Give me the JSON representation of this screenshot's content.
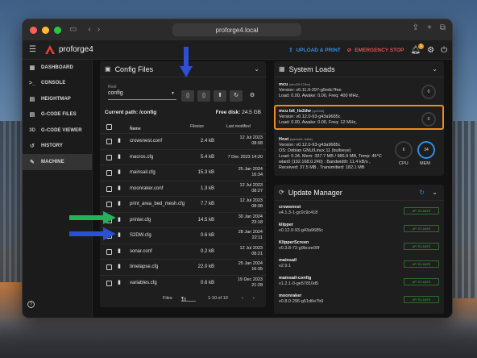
{
  "browser": {
    "url": "proforge4.local"
  },
  "app": {
    "brand": "proforge4",
    "upload_label": "UPLOAD & PRINT",
    "estop_label": "EMERGENCY STOP",
    "notification_count": "1"
  },
  "sidebar": {
    "items": [
      {
        "label": "DASHBOARD",
        "icon": "dashboard-icon"
      },
      {
        "label": "CONSOLE",
        "icon": "console-icon"
      },
      {
        "label": "HEIGHTMAP",
        "icon": "heightmap-icon"
      },
      {
        "label": "G-CODE FILES",
        "icon": "files-icon"
      },
      {
        "label": "G-CODE VIEWER",
        "icon": "3d-icon"
      },
      {
        "label": "HISTORY",
        "icon": "history-icon"
      },
      {
        "label": "MACHINE",
        "icon": "wrench-icon",
        "active": true
      }
    ]
  },
  "config": {
    "title": "Config Files",
    "root_label": "Root",
    "root_value": "config",
    "current_path_label": "Current path: /config",
    "free_disk_label": "Free disk:",
    "free_disk_value": "24.5 GB",
    "col_name": "Name",
    "col_size": "Filesize",
    "col_modified": "Last modified",
    "files": [
      {
        "name": "crowsnest.conf",
        "size": "2.4 kB",
        "date": "12 Jul 2023",
        "time": "08:08"
      },
      {
        "name": "macros.cfg",
        "size": "5.4 kB",
        "date": "7 Dec 2023 14:20",
        "time": ""
      },
      {
        "name": "mainsail.cfg",
        "size": "15.3 kB",
        "date": "25 Jan 2024",
        "time": "16:34"
      },
      {
        "name": "moonraker.conf",
        "size": "1.3 kB",
        "date": "12 Jul 2023",
        "time": "08:27"
      },
      {
        "name": "print_area_bed_mesh.cfg",
        "size": "7.7 kB",
        "date": "12 Jul 2023",
        "time": "08:08"
      },
      {
        "name": "printer.cfg",
        "size": "14.5 kB",
        "date": "30 Jan 2024",
        "time": "23:18"
      },
      {
        "name": "S2DW.cfg",
        "size": "0.6 kB",
        "date": "28 Jan 2024",
        "time": "22:11"
      },
      {
        "name": "sonar.conf",
        "size": "0.2 kB",
        "date": "12 Jul 2023",
        "time": "08:21"
      },
      {
        "name": "timelapse.cfg",
        "size": "22.0 kB",
        "date": "25 Jan 2024",
        "time": "16:35"
      },
      {
        "name": "variables.cfg",
        "size": "0.6 kB",
        "date": "19 Dec 2023",
        "time": "21:28"
      }
    ],
    "pager_label": "Files",
    "pager_size": "10",
    "pager_range": "1-10 of 10"
  },
  "system_loads": {
    "title": "System Loads",
    "mcu": {
      "name": "mcu",
      "tag": "(stm32h723xx)",
      "version": "Version: v0.11.0-297-g5edc7fee",
      "load": "Load: 0.00, Awake: 0.00, Freq: 400 MHz,",
      "gauge": "0"
    },
    "mcu2": {
      "name": "mcu btt_lis2dw",
      "tag": "(rp2040)",
      "version": "Version: v0.12.0-93-g43a9685c",
      "load": "Load: 0.00, Awake: 0.00, Freq: 12 MHz,",
      "gauge": "0"
    },
    "host": {
      "name": "Host",
      "tag": "(aarch64, 64bit)",
      "lines": [
        "Version: v0.12.0-93-g43a9685c",
        "OS: Debian GNU/Linux 11 (bullseye)",
        "Load: 0.34, Mem: 337.7 MB / 986.9 MB, Temp: 45°C",
        "wlan0 (192.168.0.240) : Bandwidth: 11.4 kB/s ,",
        "Received: 37.5 MB , Transmitted: 182.1 MB"
      ],
      "cpu_value": "6",
      "cpu_label": "CPU",
      "mem_value": "34",
      "mem_label": "MEM",
      "mem_percent": 34
    }
  },
  "update_manager": {
    "title": "Update Manager",
    "uptodate_label": "UP-TO-DATE",
    "items": [
      {
        "name": "crowsnest",
        "version": "v4.1.3-1-gc0c9c418"
      },
      {
        "name": "klipper",
        "version": "v0.12.0-93-g43a9685c"
      },
      {
        "name": "KlipperScreen",
        "version": "v0.3.8-72-g9bcee00f"
      },
      {
        "name": "mainsail",
        "version": "v2.9.1"
      },
      {
        "name": "mainsail-config",
        "version": "v1.2.1-0-ge57810d5"
      },
      {
        "name": "moonraker",
        "version": "v0.8.0-296-g51d6e7b9"
      }
    ]
  },
  "colors": {
    "accent_blue": "#2f8fe0",
    "estop_red": "#e05050",
    "highlight_orange": "#f08a24",
    "arrow_blue": "#2c4fd6",
    "arrow_green": "#22b35a",
    "up_to_date_green": "#4caf50"
  }
}
